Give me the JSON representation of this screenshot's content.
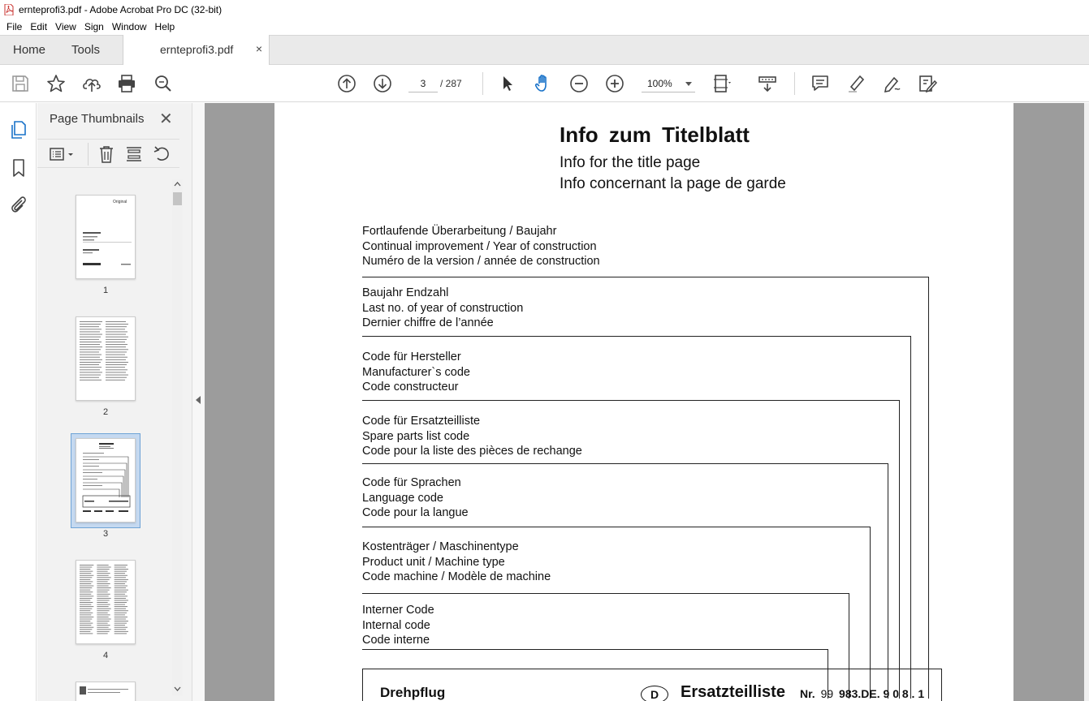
{
  "window": {
    "title": "ernteprofi3.pdf - Adobe Acrobat Pro DC (32-bit)"
  },
  "menu": [
    "File",
    "Edit",
    "View",
    "Sign",
    "Window",
    "Help"
  ],
  "tabs": {
    "home": "Home",
    "tools": "Tools",
    "document": "ernteprofi3.pdf",
    "close": "×"
  },
  "toolbar": {
    "current_page": "3",
    "total_pages": "/  287",
    "zoom": "100%",
    "icons": [
      "save-icon",
      "star-icon",
      "upload-icon",
      "print-icon",
      "find-icon",
      "page-up-icon",
      "page-down-icon",
      "select-icon",
      "hand-icon",
      "zoom-out-icon",
      "zoom-in-icon",
      "fit-page-icon",
      "scroll-mode-icon",
      "comment-icon",
      "highlight-icon",
      "sign-icon",
      "edit-icon"
    ]
  },
  "thumbnails": {
    "title": "Page Thumbnails",
    "close": "✕",
    "pages": [
      "1",
      "2",
      "3",
      "4"
    ],
    "selected": "3"
  },
  "document": {
    "title_de": "Info zum Titelblatt",
    "title_en": "Info for the title page",
    "title_fr": "Info concernant la page de garde",
    "sections": [
      [
        "Fortlaufende Überarbeitung / Baujahr",
        "Continual improvement / Year of construction",
        "Numéro de la version / année de construction"
      ],
      [
        "Baujahr Endzahl",
        "Last no. of year of construction",
        "Dernier chiffre de l’année"
      ],
      [
        "Code für Hersteller",
        "Manufacturer`s  code",
        "Code constructeur"
      ],
      [
        "Code für Ersatzteilliste",
        "Spare parts list code",
        "Code pour la liste des pièces de rechange"
      ],
      [
        "Code für Sprachen",
        "Language code",
        "Code pour la langue"
      ],
      [
        "Kostenträger / Maschinentype",
        "Product unit / Machine type",
        "Code machine / Modèle de machine"
      ],
      [
        "Interner Code",
        "Internal code",
        "Code interne"
      ]
    ],
    "footer": {
      "product": "Drehpflug",
      "lang_badge": "D",
      "list_title": "Ersatzteilliste",
      "number_prefix": "Nr.",
      "number_99": "99",
      "number_rest": "983.DE. 9 0 8 . 1"
    }
  }
}
